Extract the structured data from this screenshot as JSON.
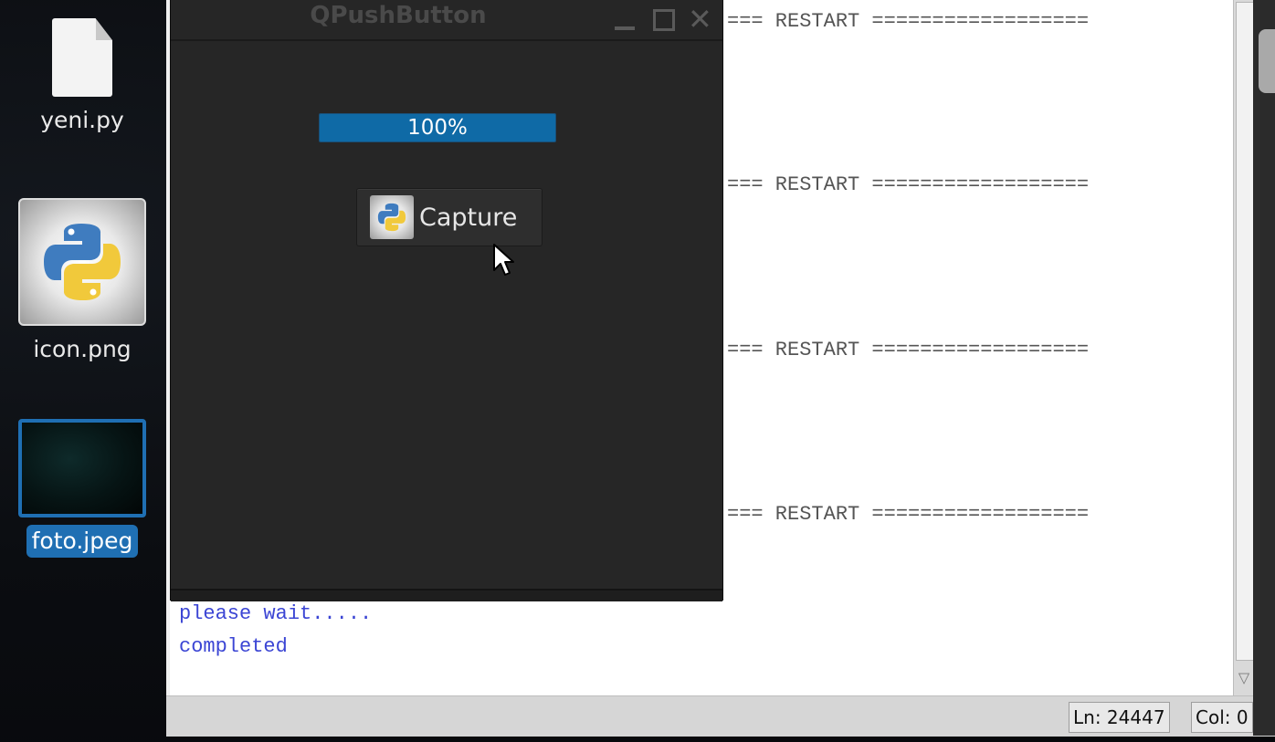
{
  "desktop": {
    "icons": [
      {
        "label": "yeni.py",
        "icon": "python-file-icon",
        "selected": false
      },
      {
        "label": "icon.png",
        "icon": "python-logo-image-icon",
        "selected": false
      },
      {
        "label": "foto.jpeg",
        "icon": "photo-thumbnail-icon",
        "selected": true
      }
    ]
  },
  "shell": {
    "restart_lines": [
      "=== RESTART ==================",
      "=== RESTART ==================",
      "=== RESTART ==================",
      "=== RESTART =================="
    ],
    "output_lines": [
      "please wait.....",
      "completed"
    ],
    "output_color": "#3b45d4",
    "status": {
      "line": "Ln: 24447",
      "col": "Col: 0"
    }
  },
  "qt_window": {
    "title": "QPushButton",
    "controls": {
      "minimize": "minimize-icon",
      "maximize": "maximize-icon",
      "close": "close-icon"
    },
    "progress": {
      "value": 100,
      "text": "100%",
      "color": "#0f6aa6"
    },
    "button": {
      "label": "Capture",
      "icon": "python-logo-icon"
    },
    "background": "#262626"
  }
}
